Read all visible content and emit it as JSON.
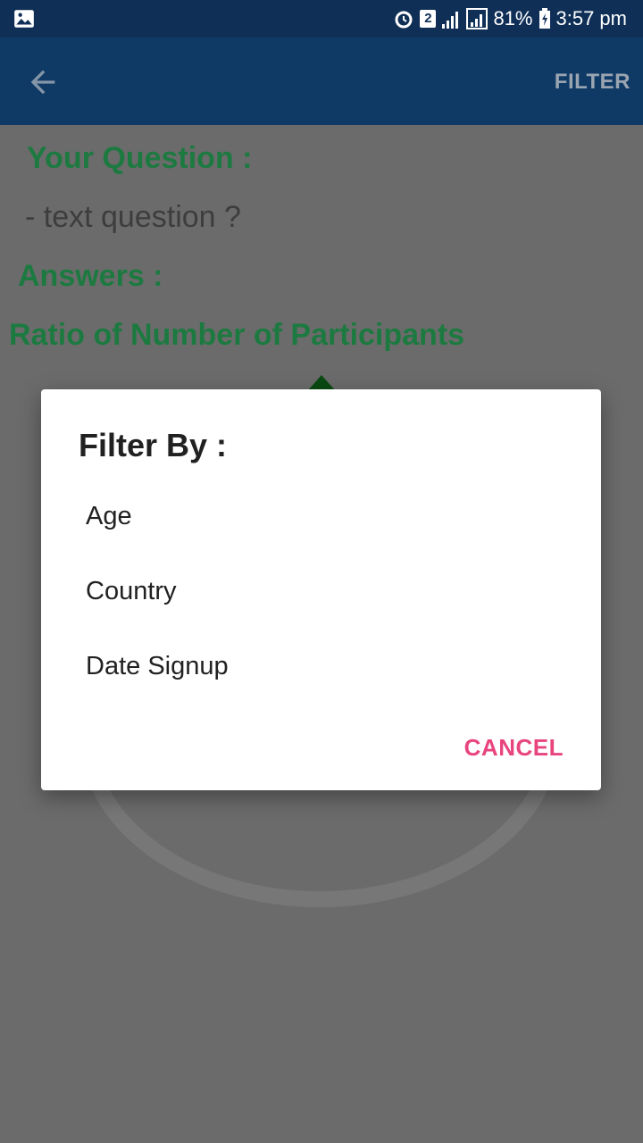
{
  "status_bar": {
    "left_icon": "image-icon",
    "icons": [
      "alarm-icon",
      "sim-2-icon",
      "signal-icon",
      "signal-icon",
      "battery-charging-icon"
    ],
    "sim_badge": "2",
    "battery": "81%",
    "time": "3:57 pm"
  },
  "app_bar": {
    "back_icon": "arrow-back-icon",
    "action_label": "FILTER"
  },
  "content": {
    "question_heading": "Your Question :",
    "question_text": "- text question  ?",
    "answers_heading": "Answers :",
    "chart_heading": "Ratio of Number of Participants"
  },
  "dialog": {
    "title": "Filter By :",
    "options": [
      "Age",
      "Country",
      "Date Signup"
    ],
    "cancel_label": "CANCEL"
  },
  "colors": {
    "status_bar": "#0f2f57",
    "app_bar": "#0f3a66",
    "heading_green": "#1c7a40",
    "accent_pink": "#e8457f",
    "scrim": "#6b6b6b"
  }
}
